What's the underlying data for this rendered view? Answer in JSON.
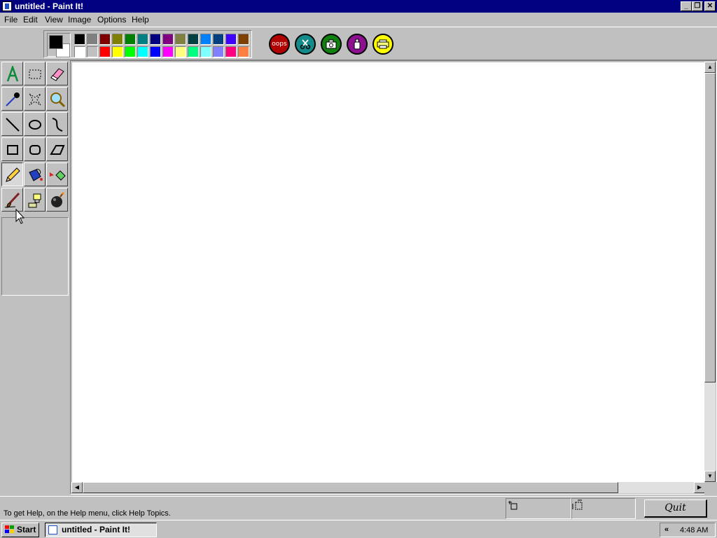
{
  "window": {
    "title": "untitled - Paint It!",
    "controls": {
      "minimize": "_",
      "maximize": "❐",
      "close": "✕"
    }
  },
  "menu": [
    "File",
    "Edit",
    "View",
    "Image",
    "Options",
    "Help"
  ],
  "palette": {
    "foreground": "#000000",
    "background": "#ffffff",
    "swatches": [
      "#000000",
      "#808080",
      "#800000",
      "#808000",
      "#008000",
      "#008080",
      "#000080",
      "#800080",
      "#808040",
      "#004040",
      "#0080ff",
      "#004080",
      "#4000ff",
      "#804000",
      "#ffffff",
      "#c0c0c0",
      "#ff0000",
      "#ffff00",
      "#00ff00",
      "#00ffff",
      "#0000ff",
      "#ff00ff",
      "#ffff80",
      "#00ff80",
      "#80ffff",
      "#8080ff",
      "#ff0080",
      "#ff8040"
    ]
  },
  "action_buttons": {
    "oops_label": "oops",
    "colors": {
      "oops": "#b00000",
      "cut": "#138b8b",
      "camera": "#108010",
      "paste": "#8c1090",
      "print": "#ffff00"
    }
  },
  "tools": [
    {
      "name": "text-tool",
      "icon": "letter-a-icon"
    },
    {
      "name": "select-tool",
      "icon": "rectangle-select-icon"
    },
    {
      "name": "eraser-tool",
      "icon": "eraser-icon"
    },
    {
      "name": "eyedropper-tool",
      "icon": "eyedropper-icon"
    },
    {
      "name": "free-select-tool",
      "icon": "free-select-icon"
    },
    {
      "name": "magnifier-tool",
      "icon": "magnifier-icon"
    },
    {
      "name": "line-tool",
      "icon": "line-icon"
    },
    {
      "name": "ellipse-tool",
      "icon": "ellipse-icon"
    },
    {
      "name": "curve-tool",
      "icon": "curve-icon"
    },
    {
      "name": "rectangle-tool",
      "icon": "rectangle-icon"
    },
    {
      "name": "rounded-rect-tool",
      "icon": "rounded-rectangle-icon"
    },
    {
      "name": "polygon-tool",
      "icon": "polygon-icon"
    },
    {
      "name": "pencil-tool",
      "icon": "pencil-icon",
      "active": true
    },
    {
      "name": "paint-bucket-tool",
      "icon": "paint-bucket-icon"
    },
    {
      "name": "spray-can-tool",
      "icon": "spray-can-icon"
    },
    {
      "name": "brush-tool",
      "icon": "brush-icon"
    },
    {
      "name": "stamp-tool",
      "icon": "stamp-icon"
    },
    {
      "name": "bomb-tool",
      "icon": "bomb-icon"
    }
  ],
  "status": {
    "help_text": "To get Help, on the Help menu, click Help Topics.",
    "quit_label": "Quit"
  },
  "taskbar": {
    "start_label": "Start",
    "task_label": "untitled - Paint It!",
    "tray_arrows": "«",
    "clock": "4:48 AM"
  }
}
